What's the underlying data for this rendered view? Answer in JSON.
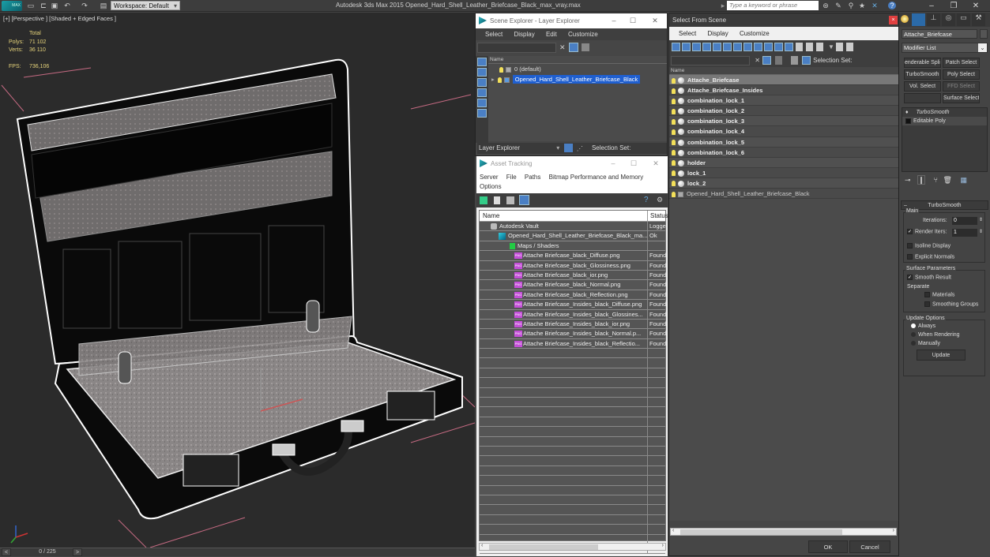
{
  "app": {
    "logo": "MAX",
    "workspace": "Workspace: Default",
    "title": "Autodesk 3ds Max  2015     Opened_Hard_Shell_Leather_Briefcase_Black_max_vray.max",
    "search_placeholder": "Type a keyword or phrase"
  },
  "viewport": {
    "label": "[+] [Perspective ] [Shaded + Edged Faces ]",
    "stats": {
      "total_label": "Total",
      "polys_label": "Polys:",
      "polys": "71 102",
      "verts_label": "Verts:",
      "verts": "36 110",
      "fps_label": "FPS:",
      "fps": "736,106"
    }
  },
  "timeline": {
    "prev": "<",
    "frame": "0 / 225",
    "next": ">"
  },
  "scene_explorer": {
    "title": "Scene Explorer - Layer Explorer",
    "menu": [
      "Select",
      "Display",
      "Edit",
      "Customize"
    ],
    "column": "Name",
    "layers": [
      {
        "name": "0 (default)",
        "selected": false
      },
      {
        "name": "Opened_Hard_Shell_Leather_Briefcase_Black",
        "selected": true
      }
    ],
    "bottom_dropdown": "Layer Explorer",
    "selection_set_label": "Selection Set:"
  },
  "asset_tracking": {
    "title": "Asset Tracking",
    "menu": [
      "Server",
      "File",
      "Paths",
      "Bitmap Performance and Memory",
      "Options"
    ],
    "columns": {
      "name": "Name",
      "status": "Status"
    },
    "rows": [
      {
        "name": "Autodesk Vault",
        "status": "Logged",
        "level": 0,
        "icon": "vault-icon"
      },
      {
        "name": "Opened_Hard_Shell_Leather_Briefcase_Black_ma...",
        "status": "Ok",
        "level": 1,
        "icon": "max-file-icon"
      },
      {
        "name": "Maps / Shaders",
        "status": "",
        "level": 2,
        "icon": "maps-icon"
      },
      {
        "name": "Attache Briefcase_black_Diffuse.png",
        "status": "Found",
        "level": 3,
        "icon": "png-icon"
      },
      {
        "name": "Attache Briefcase_black_Glossiness.png",
        "status": "Found",
        "level": 3,
        "icon": "png-icon"
      },
      {
        "name": "Attache Briefcase_black_ior.png",
        "status": "Found",
        "level": 3,
        "icon": "png-icon"
      },
      {
        "name": "Attache Briefcase_black_Normal.png",
        "status": "Found",
        "level": 3,
        "icon": "png-icon"
      },
      {
        "name": "Attache Briefcase_black_Reflection.png",
        "status": "Found",
        "level": 3,
        "icon": "png-icon"
      },
      {
        "name": "Attache Briefcase_Insides_black_Diffuse.png",
        "status": "Found",
        "level": 3,
        "icon": "png-icon"
      },
      {
        "name": "Attache Briefcase_Insides_black_Glossines...",
        "status": "Found",
        "level": 3,
        "icon": "png-icon"
      },
      {
        "name": "Attache Briefcase_Insides_black_ior.png",
        "status": "Found",
        "level": 3,
        "icon": "png-icon"
      },
      {
        "name": "Attache Briefcase_Insides_black_Normal.p...",
        "status": "Found",
        "level": 3,
        "icon": "png-icon"
      },
      {
        "name": "Attache Briefcase_Insides_black_Reflectio...",
        "status": "Found",
        "level": 3,
        "icon": "png-icon"
      }
    ]
  },
  "select_from_scene": {
    "title": "Select From Scene",
    "menu": [
      "Select",
      "Display",
      "Customize"
    ],
    "selection_set_label": "Selection Set:",
    "column": "Name",
    "objects": [
      {
        "name": "Attache_Briefcase",
        "selected": true
      },
      {
        "name": "Attache_Briefcase_Insides",
        "selected": false
      },
      {
        "name": "combination_lock_1",
        "selected": false
      },
      {
        "name": "combination_lock_2",
        "selected": false
      },
      {
        "name": "combination_lock_3",
        "selected": false
      },
      {
        "name": "combination_lock_4",
        "selected": false
      },
      {
        "name": "combination_lock_5",
        "selected": false
      },
      {
        "name": "combination_lock_6",
        "selected": false
      },
      {
        "name": "holder",
        "selected": false
      },
      {
        "name": "lock_1",
        "selected": false
      },
      {
        "name": "lock_2",
        "selected": false
      },
      {
        "name": "Opened_Hard_Shell_Leather_Briefcase_Black",
        "selected": false
      }
    ],
    "ok": "OK",
    "cancel": "Cancel"
  },
  "command_panel": {
    "object_name": "Attache_Briefcase",
    "modifier_list": "Modifier List",
    "modifier_buttons": [
      "enderable Splir",
      "Patch Select",
      "TurboSmooth",
      "Poly Select",
      "Vol. Select",
      "FFD Select",
      "",
      "Surface Select"
    ],
    "stack": [
      "TurboSmooth",
      "Editable Poly"
    ],
    "rollout_title": "TurboSmooth",
    "main_group": "Main",
    "iterations_label": "Iterations:",
    "iterations": "0",
    "render_iters_label": "Render Iters:",
    "render_iters": "1",
    "render_iters_checked": true,
    "isoline_label": "Isoline Display",
    "explicit_normals_label": "Explicit Normals",
    "surface_group": "Surface Parameters",
    "smooth_result_label": "Smooth Result",
    "separate_label": "Separate",
    "materials_label": "Materials",
    "smoothing_groups_label": "Smoothing Groups",
    "update_group": "Update Options",
    "update_options": [
      "Always",
      "When Rendering",
      "Manually"
    ],
    "update_selected": "Always",
    "update_button": "Update"
  }
}
